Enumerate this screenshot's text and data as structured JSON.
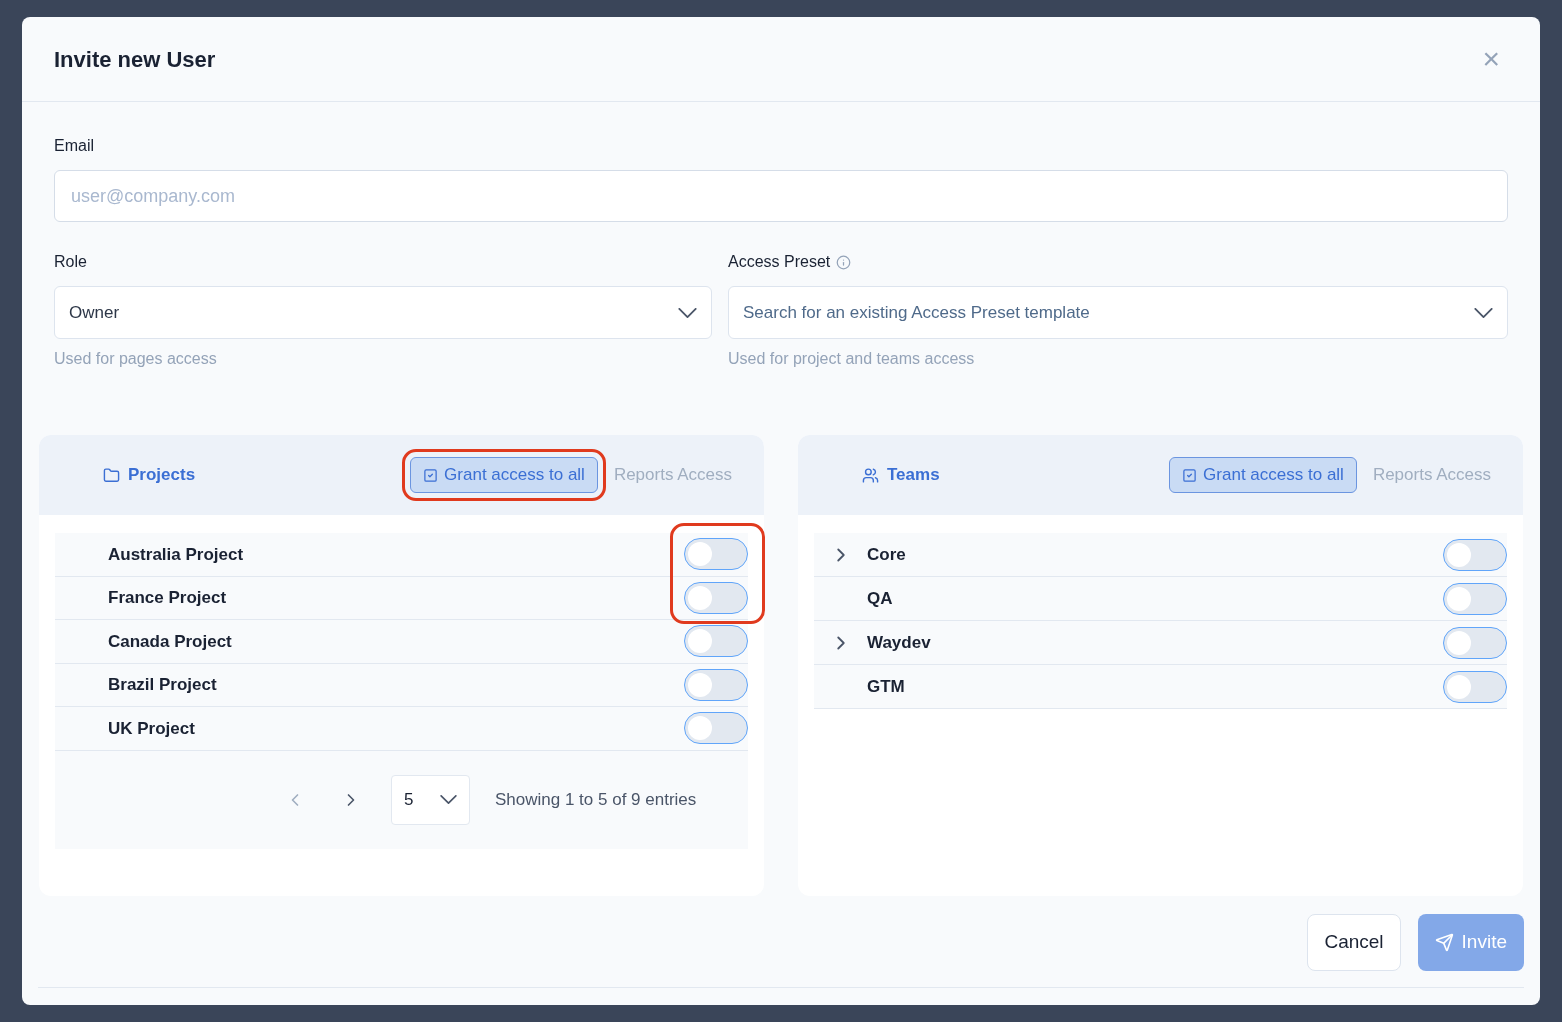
{
  "dialog": {
    "title": "Invite new User",
    "close_label": "×"
  },
  "email": {
    "label": "Email",
    "placeholder": "user@company.com"
  },
  "role": {
    "label": "Role",
    "value": "Owner",
    "helper": "Used for pages access"
  },
  "access_preset": {
    "label": "Access Preset",
    "placeholder": "Search for an existing Access Preset template",
    "helper": "Used for project and teams access"
  },
  "projects_panel": {
    "title": "Projects",
    "grant_button": "Grant access to all",
    "grant_highlighted": true,
    "reports_label": "Reports Access",
    "rows": [
      {
        "name": "Australia Project",
        "on": false,
        "highlighted": true
      },
      {
        "name": "France Project",
        "on": false,
        "highlighted": true
      },
      {
        "name": "Canada Project",
        "on": false,
        "highlighted": false
      },
      {
        "name": "Brazil Project",
        "on": false,
        "highlighted": false
      },
      {
        "name": "UK Project",
        "on": false,
        "highlighted": false
      }
    ],
    "pagination": {
      "page_size": "5",
      "summary": "Showing 1 to 5 of 9 entries"
    }
  },
  "teams_panel": {
    "title": "Teams",
    "grant_button": "Grant access to all",
    "grant_highlighted": false,
    "reports_label": "Reports Access",
    "rows": [
      {
        "name": "Core",
        "expandable": true,
        "on": false
      },
      {
        "name": "QA",
        "expandable": false,
        "on": false
      },
      {
        "name": "Waydev",
        "expandable": true,
        "on": false
      },
      {
        "name": "GTM",
        "expandable": false,
        "on": false
      }
    ]
  },
  "buttons": {
    "cancel": "Cancel",
    "invite": "Invite"
  }
}
